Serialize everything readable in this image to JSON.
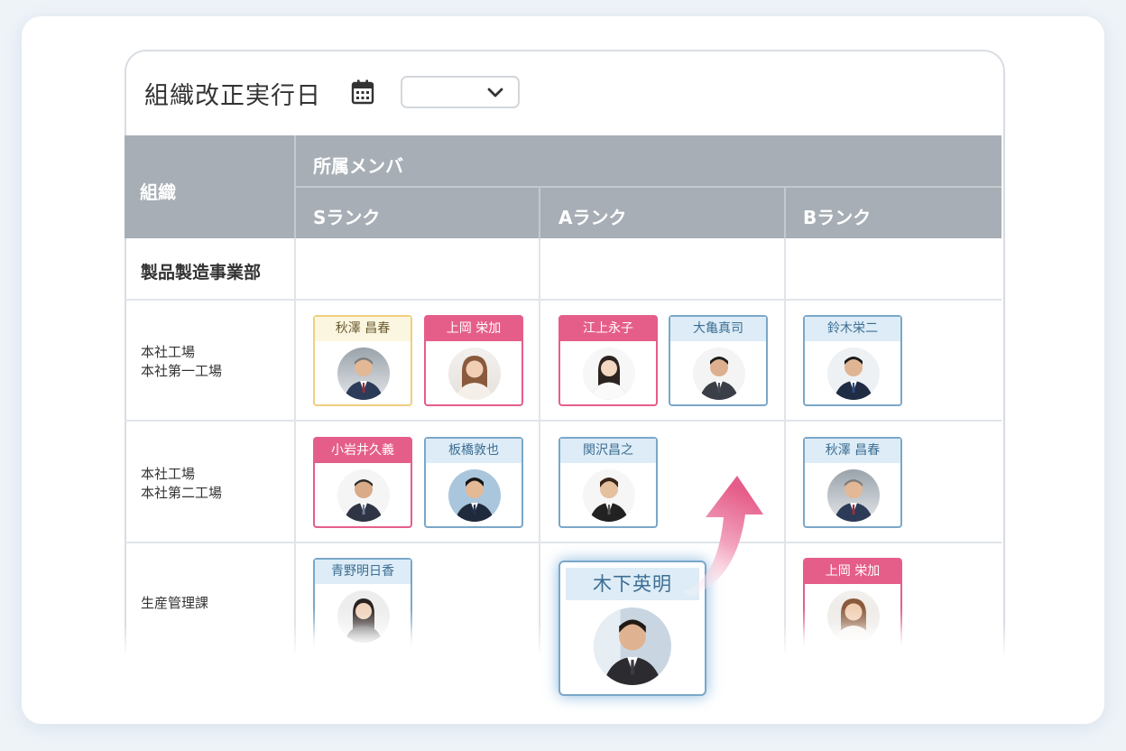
{
  "toolbar": {
    "title": "組織改正実行日",
    "calendar_icon": "calendar-icon",
    "select_value": "",
    "select_icon": "chevron-down-icon"
  },
  "table": {
    "org_header": "組織",
    "members_header": "所属メンバ",
    "rank_headers": [
      "Sランク",
      "Aランク",
      "Bランク"
    ],
    "rows": [
      {
        "org": "製品製造事業部"
      },
      {
        "org_line1": "本社工場",
        "org_line2": "本社第一工場"
      },
      {
        "org_line1": "本社工場",
        "org_line2": "本社第二工場"
      },
      {
        "org": "生産管理課"
      }
    ]
  },
  "cards": {
    "r1s1": "秋澤 昌春",
    "r1s2": "上岡 栄加",
    "r1a1": "江上永子",
    "r1a2": "大亀真司",
    "r1b1": "鈴木栄二",
    "r2s1": "小岩井久義",
    "r2s2": "板橋敦也",
    "r2a1": "関沢昌之",
    "r2b1": "秋澤 昌春",
    "r3s1": "青野明日香",
    "r3b1": "上岡 栄加"
  },
  "dragging_card": {
    "name": "木下英明"
  },
  "colors": {
    "header_bg": "#a7aeb5",
    "s_rank_yellow": "#f0cf7e",
    "pink": "#e55e8a",
    "blue": "#7aa7c9",
    "arrow": "#e55e8a"
  }
}
